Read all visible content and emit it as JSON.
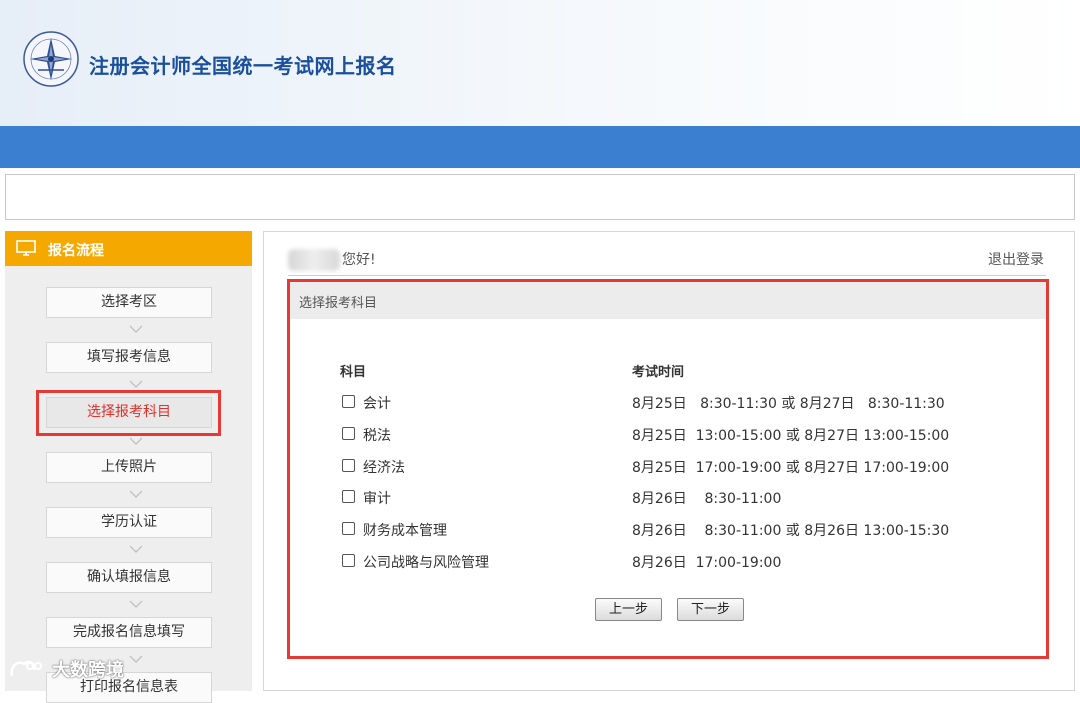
{
  "header": {
    "title": "注册会计师全国统一考试网上报名",
    "brand_color": "#1a4f9c",
    "bar_color": "#3b7fd0"
  },
  "sidebar": {
    "title": "报名流程",
    "accent_color": "#f5a800",
    "steps": [
      {
        "label": "选择考区"
      },
      {
        "label": "填写报考信息"
      },
      {
        "label": "选择报考科目",
        "active": true
      },
      {
        "label": "上传照片"
      },
      {
        "label": "学历认证"
      },
      {
        "label": "确认填报信息"
      },
      {
        "label": "完成报名信息填写"
      },
      {
        "label": "打印报名信息表"
      }
    ]
  },
  "main": {
    "greeting": "您好!",
    "logout_label": "退出登录",
    "section_title": "选择报考科目",
    "columns": {
      "subject": "科目",
      "time": "考试时间"
    },
    "subjects": [
      {
        "name": "会计",
        "time": "8月25日   8:30-11:30 或 8月27日   8:30-11:30",
        "checked": false
      },
      {
        "name": "税法",
        "time": "8月25日  13:00-15:00 或 8月27日 13:00-15:00",
        "checked": false
      },
      {
        "name": "经济法",
        "time": "8月25日  17:00-19:00 或 8月27日 17:00-19:00",
        "checked": false
      },
      {
        "name": "审计",
        "time": "8月26日    8:30-11:00",
        "checked": false
      },
      {
        "name": "财务成本管理",
        "time": "8月26日    8:30-11:00 或 8月26日 13:00-15:30",
        "checked": false
      },
      {
        "name": "公司战略与风险管理",
        "time": "8月26日  17:00-19:00",
        "checked": false
      }
    ],
    "prev_label": "上一步",
    "next_label": "下一步",
    "highlight_color": "#e53935"
  },
  "watermark": {
    "text": "大数跨境"
  }
}
